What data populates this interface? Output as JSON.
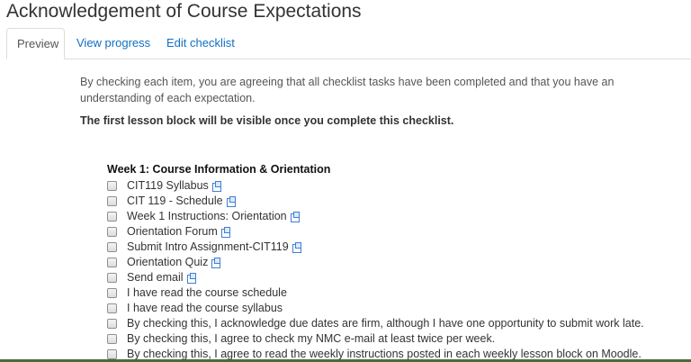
{
  "page": {
    "title": "Acknowledgement of Course Expectations",
    "accent_color": "#0f6fc5"
  },
  "tabs": [
    {
      "label": "Preview",
      "active": true
    },
    {
      "label": "View progress",
      "active": false
    },
    {
      "label": "Edit checklist",
      "active": false
    }
  ],
  "intro_text": "By checking each item, you are agreeing that all checklist tasks have been completed and that you have an understanding of each expectation.",
  "notice_text": "The first lesson block will be visible once you complete this checklist.",
  "week_heading": "Week 1: Course Information & Orientation",
  "items": [
    {
      "label": "CIT119 Syllabus",
      "link": true,
      "checked": false
    },
    {
      "label": "CIT 119 - Schedule",
      "link": true,
      "checked": false
    },
    {
      "label": "Week 1 Instructions: Orientation",
      "link": true,
      "checked": false
    },
    {
      "label": "Orientation Forum",
      "link": true,
      "checked": false
    },
    {
      "label": "Submit Intro Assignment-CIT119",
      "link": true,
      "checked": false
    },
    {
      "label": "Orientation Quiz",
      "link": true,
      "checked": false
    },
    {
      "label": "Send email",
      "link": true,
      "checked": false
    },
    {
      "label": "I have read the course schedule",
      "link": false,
      "checked": false
    },
    {
      "label": "I have read the course syllabus",
      "link": false,
      "checked": false
    },
    {
      "label": "By checking this, I acknowledge due dates are firm, although I have one opportunity to submit work late.",
      "link": false,
      "checked": false
    },
    {
      "label": "By checking this, I agree to check my NMC e-mail at least twice per week.",
      "link": false,
      "checked": false
    },
    {
      "label": "By checking this, I agree to read the weekly instructions posted in each weekly lesson block on Moodle.",
      "link": false,
      "checked": false
    }
  ]
}
